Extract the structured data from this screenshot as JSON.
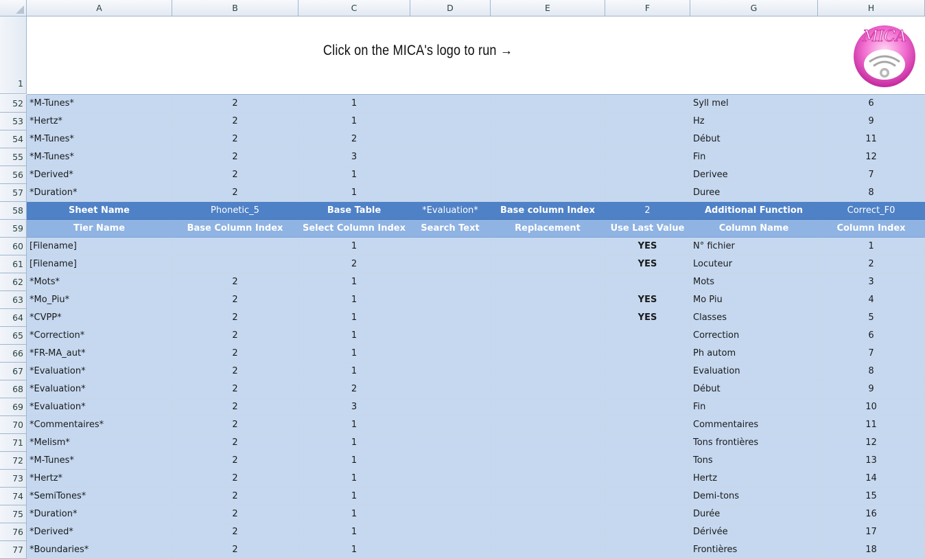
{
  "columns": [
    "A",
    "B",
    "C",
    "D",
    "E",
    "F",
    "G",
    "H"
  ],
  "banner": {
    "text": "Click on the MICA's logo to run →",
    "logo_text": "MICA",
    "row_number": "1"
  },
  "colors": {
    "data_fill": "#c5d8ef",
    "header_fill": "#4f81c7",
    "subheader_fill": "#8fb3e2",
    "logo_pink": "#e04ab8"
  },
  "rows_top": [
    {
      "n": "52",
      "a": "*M-Tunes*",
      "b": "2",
      "c": "1",
      "f": "",
      "g": "Syll mel",
      "h": "6"
    },
    {
      "n": "53",
      "a": "*Hertz*",
      "b": "2",
      "c": "1",
      "f": "",
      "g": "Hz",
      "h": "9"
    },
    {
      "n": "54",
      "a": "*M-Tunes*",
      "b": "2",
      "c": "2",
      "f": "",
      "g": "Début",
      "h": "11"
    },
    {
      "n": "55",
      "a": "*M-Tunes*",
      "b": "2",
      "c": "3",
      "f": "",
      "g": "Fin",
      "h": "12"
    },
    {
      "n": "56",
      "a": "*Derived*",
      "b": "2",
      "c": "1",
      "f": "",
      "g": "Derivee",
      "h": "7"
    },
    {
      "n": "57",
      "a": "*Duration*",
      "b": "2",
      "c": "1",
      "f": "",
      "g": "Duree",
      "h": "8"
    }
  ],
  "row58": {
    "n": "58",
    "a": "Sheet Name",
    "b": "Phonetic_5",
    "c": "Base Table",
    "d": "*Evaluation*",
    "e": "Base column Index",
    "f": "2",
    "g": "Additional Function",
    "h": "Correct_F0"
  },
  "row59": {
    "n": "59",
    "a": "Tier Name",
    "b": "Base Column Index",
    "c": "Select Column Index",
    "d": "Search Text",
    "e": "Replacement",
    "f": "Use Last Value",
    "g": "Column Name",
    "h": "Column Index"
  },
  "rows_bottom": [
    {
      "n": "60",
      "a": "[Filename]",
      "b": "",
      "c": "1",
      "f": "YES",
      "g": "N° fichier",
      "h": "1"
    },
    {
      "n": "61",
      "a": "[Filename]",
      "b": "",
      "c": "2",
      "f": "YES",
      "g": "Locuteur",
      "h": "2"
    },
    {
      "n": "62",
      "a": "*Mots*",
      "b": "2",
      "c": "1",
      "f": "",
      "g": "Mots",
      "h": "3"
    },
    {
      "n": "63",
      "a": "*Mo_Piu*",
      "b": "2",
      "c": "1",
      "f": "YES",
      "g": "Mo Piu",
      "h": "4"
    },
    {
      "n": "64",
      "a": "*CVPP*",
      "b": "2",
      "c": "1",
      "f": "YES",
      "g": "Classes",
      "h": "5"
    },
    {
      "n": "65",
      "a": "*Correction*",
      "b": "2",
      "c": "1",
      "f": "",
      "g": "Correction",
      "h": "6"
    },
    {
      "n": "66",
      "a": "*FR-MA_aut*",
      "b": "2",
      "c": "1",
      "f": "",
      "g": "Ph autom",
      "h": "7"
    },
    {
      "n": "67",
      "a": "*Evaluation*",
      "b": "2",
      "c": "1",
      "f": "",
      "g": "Evaluation",
      "h": "8"
    },
    {
      "n": "68",
      "a": "*Evaluation*",
      "b": "2",
      "c": "2",
      "f": "",
      "g": "Début",
      "h": "9"
    },
    {
      "n": "69",
      "a": "*Evaluation*",
      "b": "2",
      "c": "3",
      "f": "",
      "g": "Fin",
      "h": "10"
    },
    {
      "n": "70",
      "a": "*Commentaires*",
      "b": "2",
      "c": "1",
      "f": "",
      "g": "Commentaires",
      "h": "11"
    },
    {
      "n": "71",
      "a": "*Melism*",
      "b": "2",
      "c": "1",
      "f": "",
      "g": "Tons frontières",
      "h": "12"
    },
    {
      "n": "72",
      "a": "*M-Tunes*",
      "b": "2",
      "c": "1",
      "f": "",
      "g": "Tons",
      "h": "13"
    },
    {
      "n": "73",
      "a": "*Hertz*",
      "b": "2",
      "c": "1",
      "f": "",
      "g": "Hertz",
      "h": "14"
    },
    {
      "n": "74",
      "a": "*SemiTones*",
      "b": "2",
      "c": "1",
      "f": "",
      "g": "Demi-tons",
      "h": "15"
    },
    {
      "n": "75",
      "a": "*Duration*",
      "b": "2",
      "c": "1",
      "f": "",
      "g": "Durée",
      "h": "16"
    },
    {
      "n": "76",
      "a": "*Derived*",
      "b": "2",
      "c": "1",
      "f": "",
      "g": "Dérivée",
      "h": "17"
    },
    {
      "n": "77",
      "a": "*Boundaries*",
      "b": "2",
      "c": "1",
      "f": "",
      "g": "Frontières",
      "h": "18"
    }
  ]
}
